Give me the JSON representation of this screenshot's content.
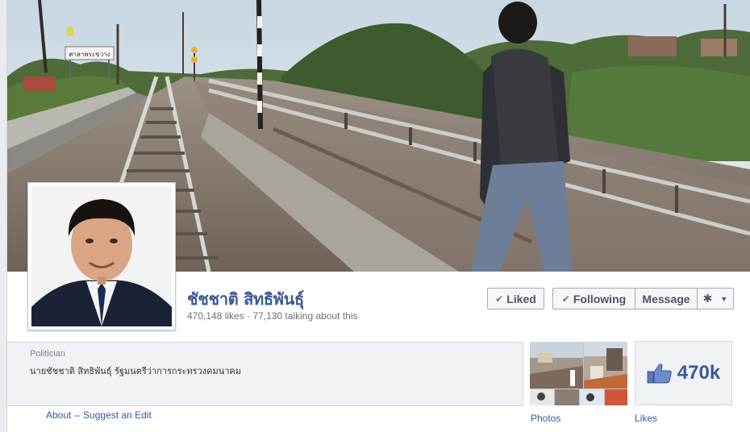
{
  "page": {
    "name": "ชัชชาติ สิทธิพันธุ์",
    "likes_text": "470,148 likes",
    "stats_separator": " · ",
    "talking_text": "77,130 talking about this"
  },
  "actions": {
    "liked_label": "Liked",
    "following_label": "Following",
    "message_label": "Message",
    "check_glyph": "✔",
    "gear_glyph": "✱",
    "caret_glyph": "▼"
  },
  "about": {
    "category": "Politician",
    "description": "นายชัชชาติ สิทธิพันธุ์ รัฐมนตรีว่าการกระทรวงคมนาคม",
    "about_link": "About",
    "separator": "–",
    "suggest_edit_link": "Suggest an Edit"
  },
  "cover": {
    "station_sign": "ศาลาพระขวาง"
  },
  "tiles": {
    "photos_label": "Photos",
    "likes_label": "Likes",
    "likes_count": "470k"
  },
  "colors": {
    "brand_blue": "#3b5998",
    "button_bg": "#f6f7f9",
    "panel_bg": "#f0f2f5"
  }
}
